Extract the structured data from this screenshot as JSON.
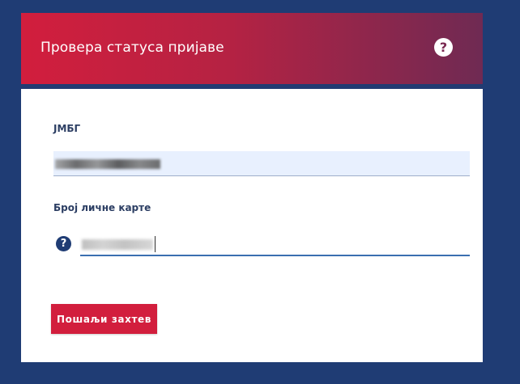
{
  "header": {
    "title": "Провера статуса пријаве",
    "help_icon_glyph": "?",
    "gradient_colors": [
      "#d21e3d",
      "#6f2a53"
    ]
  },
  "form": {
    "jmbg_label": "ЈМБГ",
    "jmbg_value_obscured": true,
    "card_label": "Број личне карте",
    "card_help_glyph": "?",
    "card_value_obscured": true,
    "submit_label": "Пошаљи захтев"
  },
  "colors": {
    "background": "#1f3c74",
    "accent": "#d21e3d",
    "input_autofill": "#e8f0fe",
    "focus_underline": "#3a6fb0"
  },
  "icons": {
    "header_help": "question-circle-icon",
    "field_help": "question-circle-icon"
  }
}
